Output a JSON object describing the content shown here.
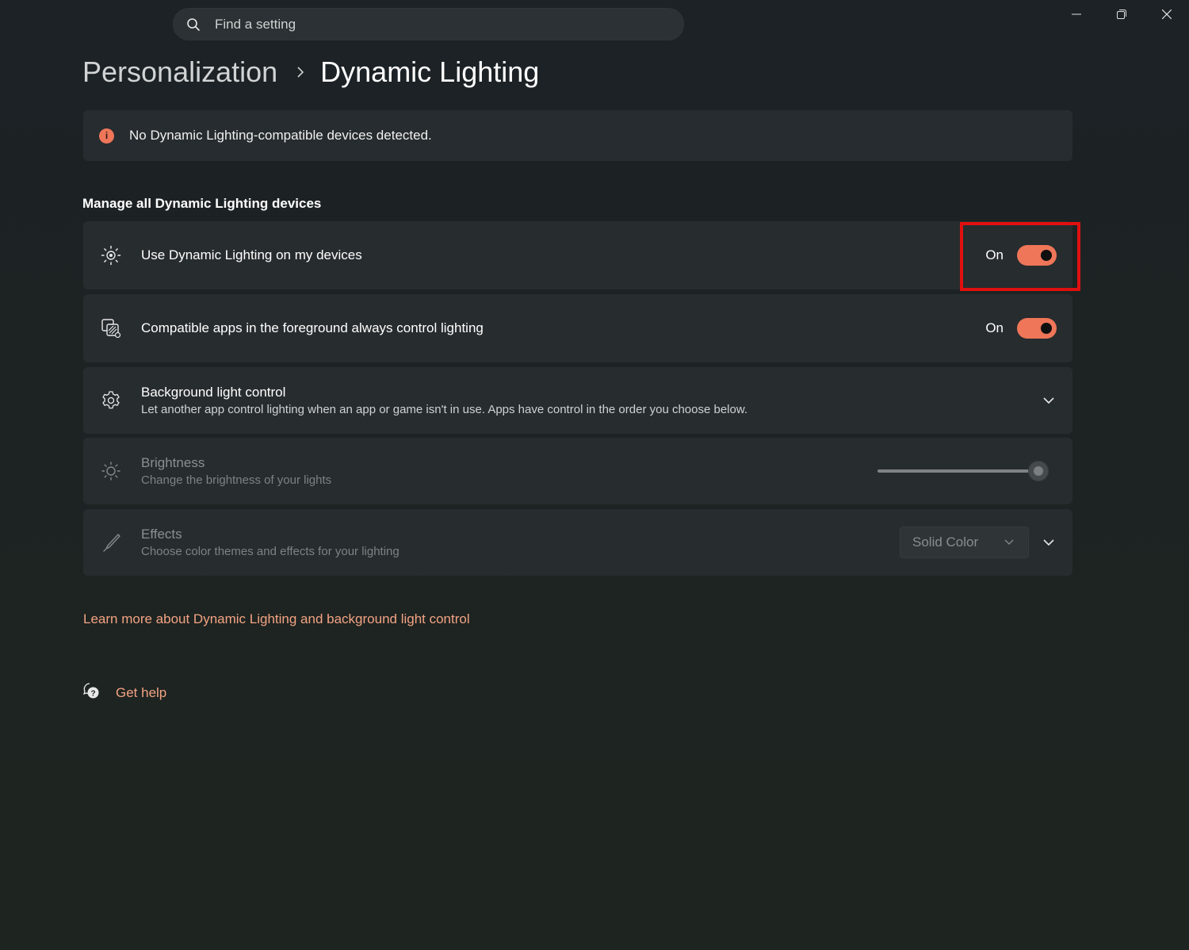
{
  "search": {
    "placeholder": "Find a setting",
    "icon": "search-icon"
  },
  "window_controls": {
    "minimize": "minimize-icon",
    "restore": "restore-icon",
    "close": "close-icon"
  },
  "breadcrumb": {
    "parent": "Personalization",
    "current": "Dynamic Lighting"
  },
  "infobar": {
    "icon": "info-icon",
    "icon_glyph": "i",
    "message": "No Dynamic Lighting-compatible devices detected.",
    "accent": "#ef7658"
  },
  "section": {
    "title": "Manage all Dynamic Lighting devices"
  },
  "settings": [
    {
      "id": "use-dynamic-lighting",
      "icon": "dynamic-lighting-icon",
      "title": "Use Dynamic Lighting on my devices",
      "control": "toggle",
      "state_label": "On",
      "value": true
    },
    {
      "id": "foreground-apps-control",
      "icon": "apps-control-icon",
      "title": "Compatible apps in the foreground always control lighting",
      "control": "toggle",
      "state_label": "On",
      "value": true
    },
    {
      "id": "background-light-control",
      "icon": "gear-icon",
      "title": "Background light control",
      "description": "Let another app control lighting when an app or game isn't in use. Apps have control in the order you choose below.",
      "control": "expander"
    },
    {
      "id": "brightness",
      "icon": "brightness-icon",
      "title": "Brightness",
      "description": "Change the brightness of your lights",
      "control": "slider",
      "value": 100,
      "disabled": true
    },
    {
      "id": "effects",
      "icon": "brush-icon",
      "title": "Effects",
      "description": "Choose color themes and effects for your lighting",
      "control": "dropdown",
      "selected": "Solid Color",
      "disabled": true
    }
  ],
  "learn_more": {
    "label": "Learn more about Dynamic Lighting and background light control"
  },
  "help": {
    "label": "Get help",
    "icon": "help-icon"
  },
  "colors": {
    "accent": "#ef7658",
    "link": "#f3a383",
    "highlight": "#e01010"
  }
}
